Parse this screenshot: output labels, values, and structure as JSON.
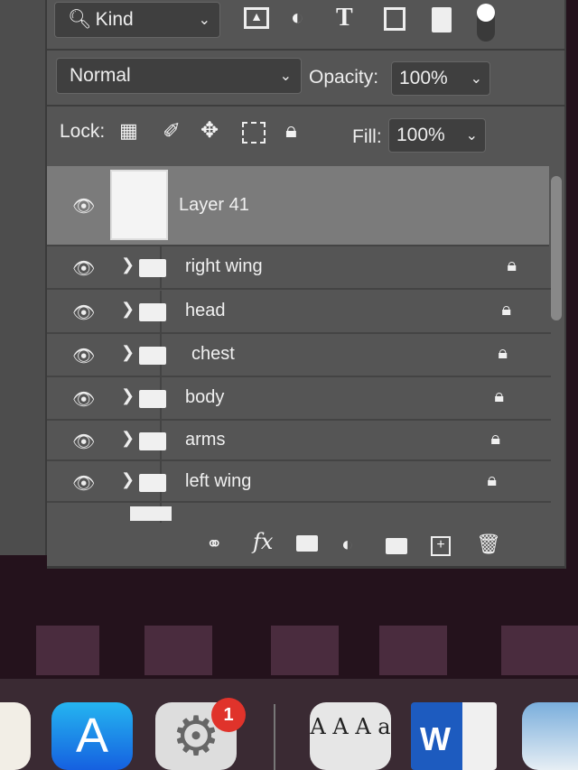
{
  "filter": {
    "kind_label": "Kind",
    "icons": [
      "image-filter-icon",
      "adjustment-filter-icon",
      "type-filter-icon",
      "shape-filter-icon",
      "smart-object-filter-icon",
      "filter-toggle"
    ]
  },
  "blend": {
    "mode": "Normal",
    "opacity_label": "Opacity:",
    "opacity": "100%"
  },
  "lock": {
    "label": "Lock:",
    "fill_label": "Fill:",
    "fill": "100%"
  },
  "layers": [
    {
      "name": "Layer 41",
      "selected": true
    },
    {
      "name": "right wing",
      "type": "group",
      "locked": true
    },
    {
      "name": "head",
      "type": "group",
      "locked": true
    },
    {
      "name": "chest",
      "type": "group",
      "locked": true
    },
    {
      "name": "body",
      "type": "group",
      "locked": true
    },
    {
      "name": "arms",
      "type": "group",
      "locked": true
    },
    {
      "name": "left wing",
      "type": "group",
      "locked": true
    }
  ],
  "footer": {
    "fx": "fx"
  },
  "dock": {
    "settings_badge": "1",
    "font_book_glyphs": "A A A a",
    "word_letter": "W"
  },
  "colors": {
    "panel": "#555555",
    "selected_row": "#7b7b7b",
    "badge": "#e0332b"
  }
}
